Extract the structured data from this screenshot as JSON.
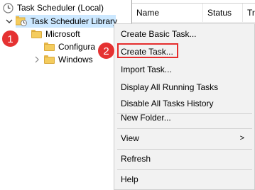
{
  "tree": {
    "root_label": "Task Scheduler (Local)",
    "library_label": "Task Scheduler Library",
    "microsoft_label": "Microsoft",
    "configura_label": "Configura",
    "windows_label": "Windows"
  },
  "right_pane": {
    "columns": [
      "Name",
      "Status",
      "Tr"
    ]
  },
  "context_menu": {
    "items": [
      "Create Basic Task...",
      "Create Task...",
      "Import Task...",
      "Display All Running Tasks",
      "Disable All Tasks History",
      "New Folder...",
      "View",
      "Refresh",
      "Help"
    ],
    "submenu_arrow": ">"
  },
  "annotations": {
    "badge1": "1",
    "badge2": "2",
    "badge_color": "#e53232",
    "highlight_color": "#e52d2d"
  },
  "colors": {
    "selection": "#cce8ff",
    "menu_bg": "#f2f2f2",
    "folder": "#f4cc5e"
  }
}
